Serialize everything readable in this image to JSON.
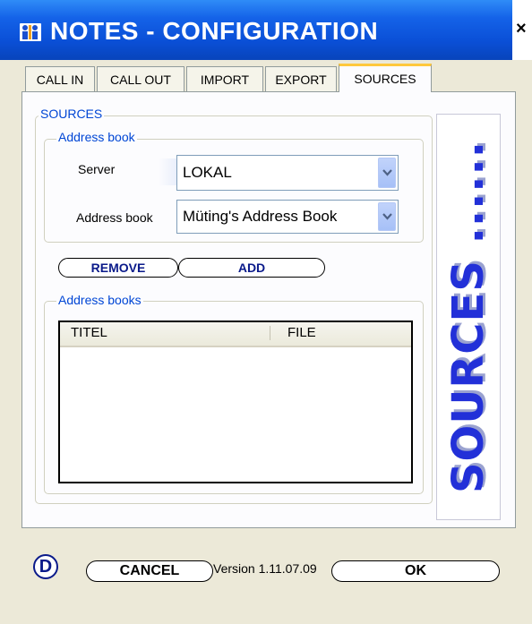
{
  "window": {
    "title": "NOTES - CONFIGURATION",
    "close_symbol": "×",
    "app_icon": "phone-people-icon"
  },
  "tabs": [
    {
      "label": "CALL IN",
      "active": false
    },
    {
      "label": "CALL OUT",
      "active": false
    },
    {
      "label": "IMPORT",
      "active": false
    },
    {
      "label": "EXPORT",
      "active": false
    },
    {
      "label": "SOURCES",
      "active": true
    }
  ],
  "sources": {
    "group_label": "SOURCES",
    "address_book_group": {
      "label": "Address book",
      "server_label": "Server",
      "server_value": "LOKAL",
      "address_book_label": "Address book",
      "address_book_value": "Müting's Address Book"
    },
    "buttons": {
      "remove": "REMOVE",
      "add": "ADD"
    },
    "address_books_group": {
      "label": "Address books",
      "columns": [
        "TITEL",
        "FILE"
      ],
      "rows": []
    },
    "banner_text": "SOURCES ......"
  },
  "footer": {
    "logo_letter": "D",
    "cancel": "CANCEL",
    "version": "Version 1.11.07.09",
    "ok": "OK"
  },
  "colors": {
    "title_bar": "#0a4fd6",
    "legend_text": "#0046d5",
    "active_tab_highlight": "#ffc83c",
    "banner_text": "#2230d8"
  }
}
